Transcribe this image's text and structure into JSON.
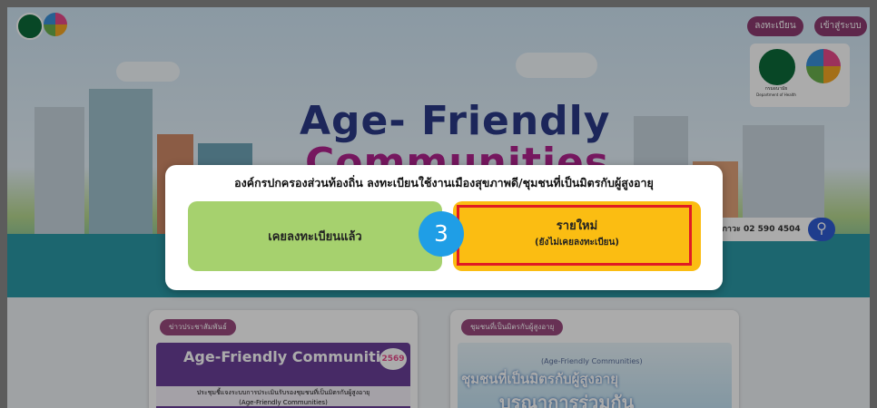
{
  "header": {
    "register_label": "ลงทะเบียน",
    "login_label": "เข้าสู่ระบบ"
  },
  "hero": {
    "title_line1": "Age- Friendly",
    "title_line2": "Communities",
    "ministry_label": "กรมอนามัย",
    "ministry_sub": "Department of Health",
    "phone_text": "ภาวะ 02 590 4504"
  },
  "modal": {
    "title": "องค์กรปกครองส่วนท้องถิ่น ลงทะเบียนใช้งานเมืองสุขภาพดี/ชุมชนที่เป็นมิตรกับผู้สูงอายุ",
    "existing_label": "เคยลงทะเบียนแล้ว",
    "new_label": "รายใหม่",
    "new_sub": "(ยังไม่เคยลงทะเบียน)"
  },
  "step_number": "3",
  "cards": {
    "news_tag": "ข่าวประชาสัมพันธ์",
    "news_banner": "Age-Friendly Communities",
    "news_year": "2569",
    "news_caption1": "ประชุมชี้แจงระบบการประเมินรับรองชุมชนที่เป็นมิตรกับผู้สูงอายุ",
    "news_caption2": "(Age-Friendly Communities)",
    "community_tag": "ชุมชนที่เป็นมิตรกับผู้สูงอายุ",
    "community_banner": "ชุมชนที่เป็นมิตรกับผู้สูงอายุ",
    "community_banner_en": "(Age-Friendly Communities)",
    "community_banner2": "บูรณาการร่วมกัน"
  },
  "colors": {
    "accent_pill": "#8c3b70",
    "option_existing": "#a6d16e",
    "option_new": "#fbbd12",
    "highlight": "#e01b24",
    "step_badge": "#1f9ee6"
  }
}
